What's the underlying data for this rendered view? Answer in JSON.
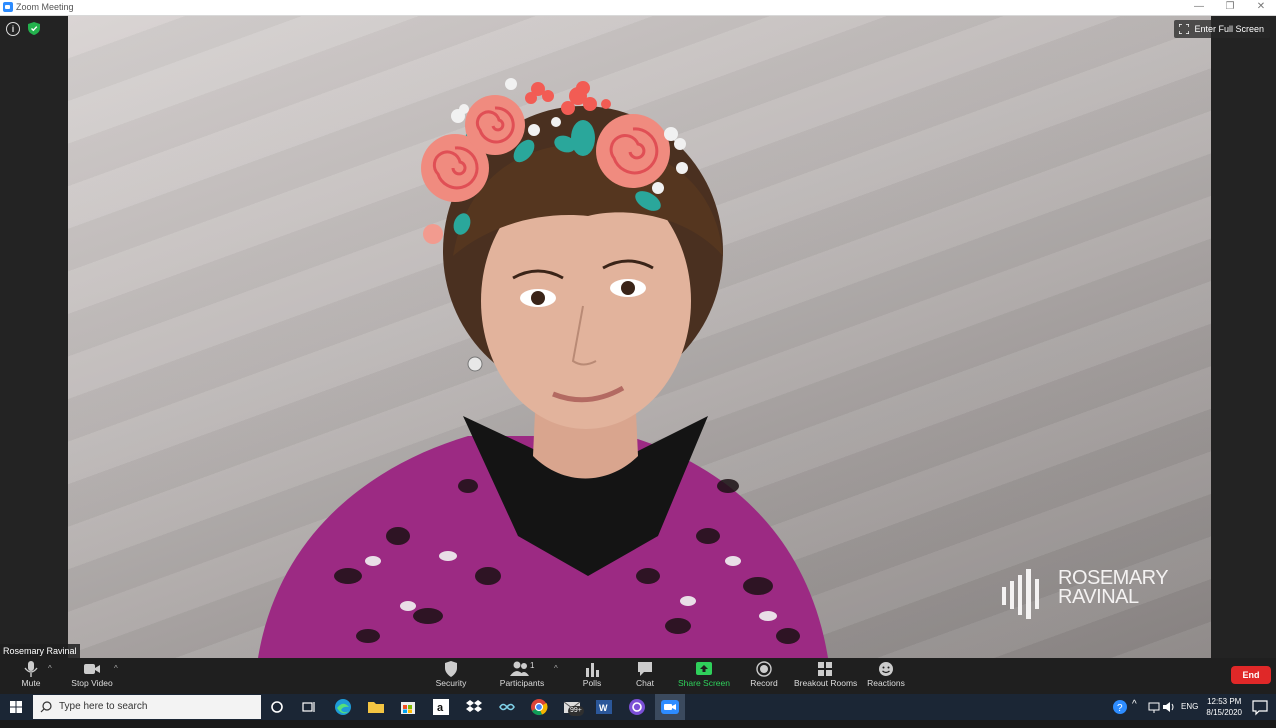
{
  "window": {
    "title": "Zoom Meeting"
  },
  "video": {
    "fullscreen_label": "Enter Full Screen",
    "participant_name": "Rosemary Ravinal",
    "logo_line1": "ROSEMARY",
    "logo_line2": "RAVINAL"
  },
  "toolbar": {
    "mute": "Mute",
    "stop_video": "Stop Video",
    "security": "Security",
    "participants": "Participants",
    "participants_count": "1",
    "polls": "Polls",
    "chat": "Chat",
    "share_screen": "Share Screen",
    "record": "Record",
    "breakout_rooms": "Breakout Rooms",
    "reactions": "Reactions",
    "end": "End"
  },
  "taskbar": {
    "search_placeholder": "Type here to search",
    "mail_badge": "99+",
    "language": "ENG",
    "time": "12:53 PM",
    "date": "8/15/2020"
  },
  "colors": {
    "share_green": "#2fd05b",
    "end_red": "#e02828",
    "zoom_blue": "#2d8cff"
  }
}
